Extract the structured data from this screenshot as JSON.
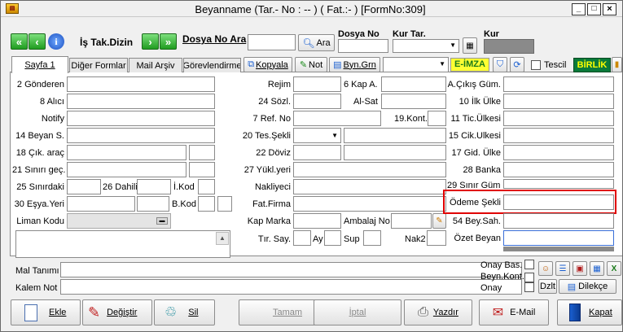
{
  "window": {
    "title": "Beyanname (Tar.- No :  -- ) ( Fat.:- )  [FormNo:309]"
  },
  "toolbar": {
    "is_takip_label": "İş Tak.Dizin",
    "dosya_no_ara_label": "Dosya No Ara",
    "ara_button": "Ara",
    "dosya_no_header": "Dosya No",
    "kur_tar_header": "Kur Tar.",
    "kur_header": "Kur"
  },
  "tabs": [
    {
      "label": "Sayfa 1"
    },
    {
      "label": "Diğer Formlar"
    },
    {
      "label": "Mail Arşiv"
    },
    {
      "label": "Görevlendirme"
    }
  ],
  "tab_buttons": {
    "kopyala": "Kopyala",
    "not": "Not",
    "byn_grn": "Byn.Grn",
    "e_imza": "E-İMZA",
    "tescil": "Tescil",
    "birlik": "BİRLİK"
  },
  "left_fields": {
    "gonderen": "2 Gönderen",
    "alici": "8 Alıcı",
    "notify": "Notify",
    "beyan_s": "14 Beyan S.",
    "cik_arac": "18 Çık. araç",
    "sinir_gec": "21 Sınırı geç.",
    "sinirdaki": "25 Sınırdaki",
    "dahili": "26 Dahili",
    "i_kod": "İ.Kod",
    "esya_yeri": "30 Eşya.Yeri",
    "b_kod": "B.Kod",
    "liman_kodu": "Liman Kodu"
  },
  "mid_fields": {
    "rejim": "Rejim",
    "kap_a": "6 Kap A.",
    "sozl": "24 Sözl.",
    "al_sat": "Al-Sat",
    "ref_no": "7 Ref. No",
    "kont": "19.Kont.",
    "tes_sekli": "20 Tes.Şekli",
    "doviz": "22 Döviz",
    "yukl_yeri": "27 Yükl.yeri",
    "nakliyeci": "Nakliyeci",
    "fat_firma": "Fat.Firma",
    "kap_marka": "Kap Marka",
    "ambalaj_no": "Ambalaj No",
    "tir_say": "Tır. Say.",
    "ay": "Ay",
    "sup": "Sup",
    "nak2": "Nak2"
  },
  "right_fields": {
    "a_cikis_gum": "A.Çıkış Güm.",
    "ilk_ulke": "10 İlk Ülke",
    "tic_ulkesi": "11 Tic.Ülkesi",
    "cik_ulkesi": "15 Cik.Ulkesi",
    "gid_ulke": "17 Gid. Ülke",
    "banka": "28 Banka",
    "sinir_gum": "29 Sınır Güm.",
    "odeme_sekli": "Ödeme Şekli",
    "bey_sah": "54 Bey.Sah.",
    "ozet_beyan": "Özet Beyan"
  },
  "bottom": {
    "mal_tanimi": "Mal Tanımı",
    "kalem_not": "Kalem Not",
    "onay_bas": "Onay Bas.",
    "beyn_kont": "Beyn.Kont.",
    "onay": "Onay",
    "dzlt": "Dzlt",
    "dilekce": "Dilekçe"
  },
  "actions": {
    "ekle": "Ekle",
    "degistir": "Değiştir",
    "sil": "Sil",
    "tamam": "Tamam",
    "iptal": "İptal",
    "yazdir": "Yazdır",
    "email": "E-Mail",
    "kapat": "Kapat"
  },
  "colors": {
    "highlight": "#e00000",
    "birlik_bg": "#0a7a3a",
    "birlik_fg": "#ffff00",
    "eimza_fg": "#1a7a1a",
    "eimza_bg": "#ffff33",
    "active_input_border": "#3a6fd8"
  }
}
